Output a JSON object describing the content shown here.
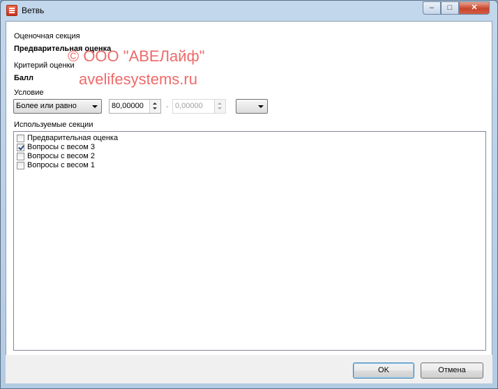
{
  "window": {
    "title": "Ветвь",
    "minimize": "–",
    "maximize": "□",
    "close": "✕"
  },
  "watermark": {
    "line1": "© ООО \"АВЕЛайф\"",
    "line2": "avelifesystems.ru"
  },
  "form": {
    "section_label": "Оценочная секция",
    "section_value": "Предварительная оценка",
    "criterion_label": "Критерий оценки",
    "criterion_value": "Балл",
    "condition_label": "Условие",
    "condition_selected": "Более или равно",
    "value_from": "80,00000",
    "range_dash": "-",
    "value_to": "0,00000",
    "extra_selected": "",
    "used_sections_label": "Используемые секции"
  },
  "sections": [
    {
      "label": "Предварительная оценка",
      "checked": false
    },
    {
      "label": "Вопросы с весом 3",
      "checked": true
    },
    {
      "label": "Вопросы с весом 2",
      "checked": false
    },
    {
      "label": "Вопросы с весом 1",
      "checked": false
    }
  ],
  "buttons": {
    "ok": "OK",
    "cancel": "Отмена"
  }
}
